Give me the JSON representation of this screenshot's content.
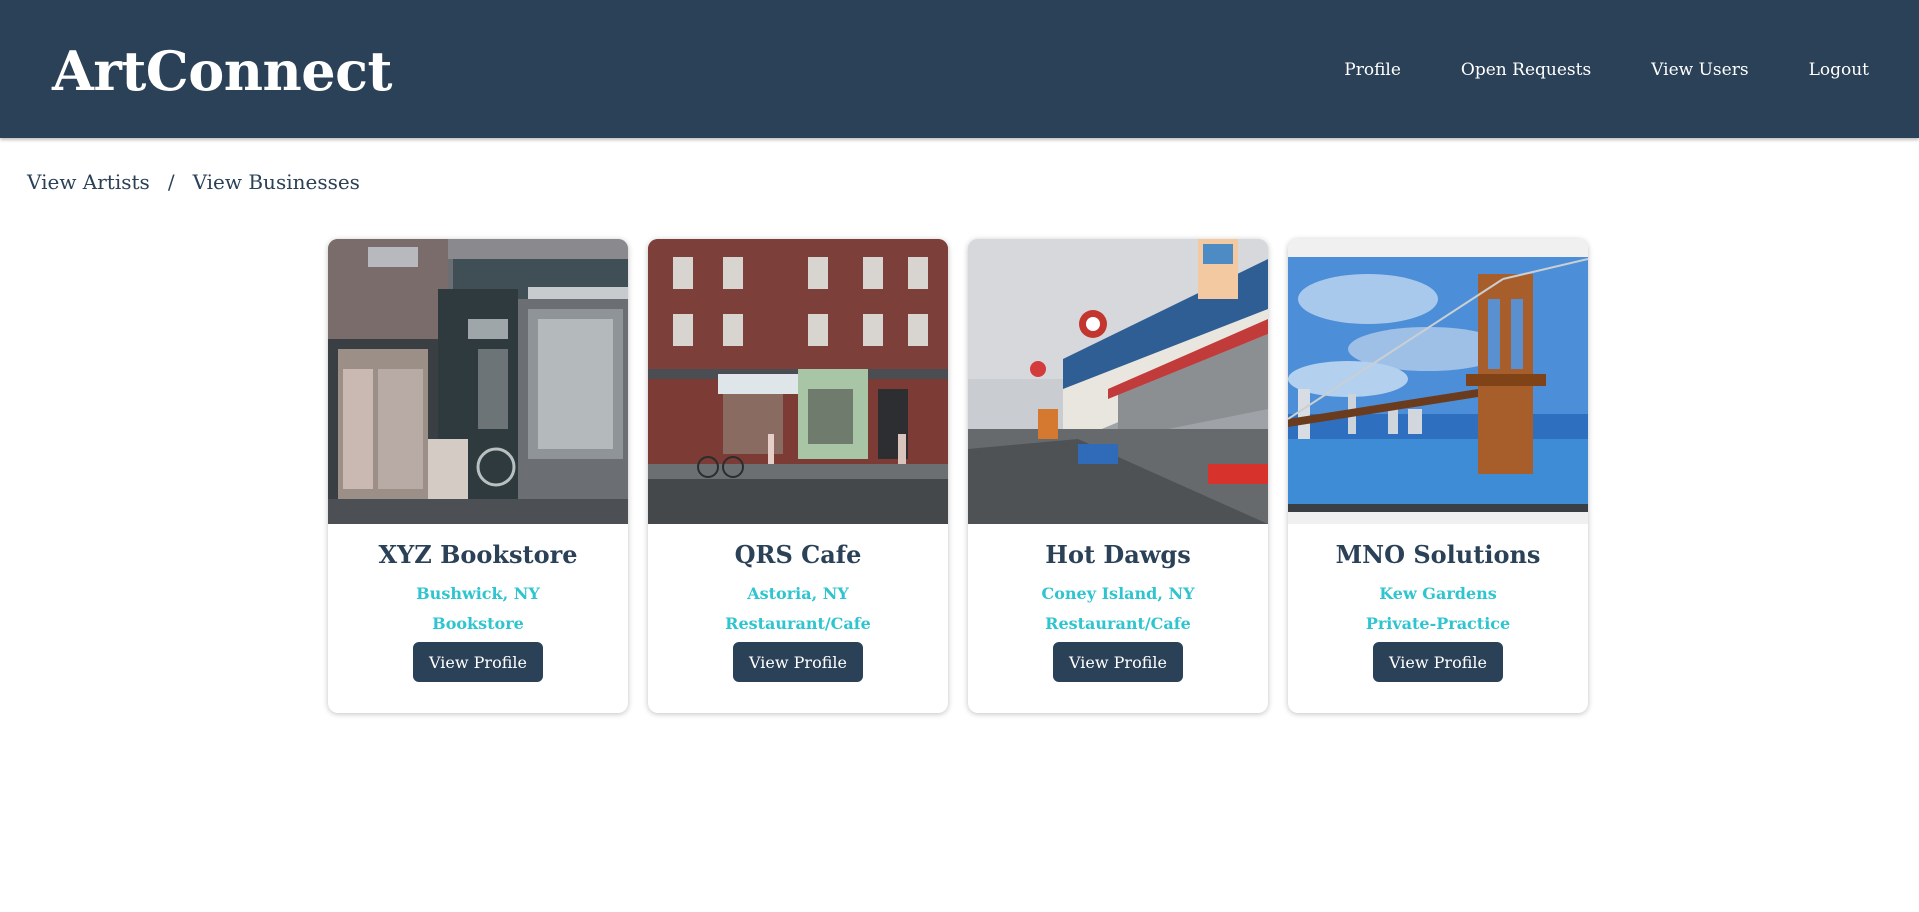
{
  "header": {
    "brand": "ArtConnect",
    "nav": [
      "Profile",
      "Open Requests",
      "View Users",
      "Logout"
    ]
  },
  "breadcrumb": {
    "artists": "View Artists",
    "separator": "/",
    "businesses": "View Businesses"
  },
  "cards": [
    {
      "name": "XYZ Bookstore",
      "location": "Bushwick, NY",
      "category": "Bookstore",
      "button": "View Profile",
      "image": "bookstore-storefront"
    },
    {
      "name": "QRS Cafe",
      "location": "Astoria, NY",
      "category": "Restaurant/Cafe",
      "button": "View Profile",
      "image": "brick-building-street"
    },
    {
      "name": "Hot Dawgs",
      "location": "Coney Island, NY",
      "category": "Restaurant/Cafe",
      "button": "View Profile",
      "image": "boardwalk-storefronts"
    },
    {
      "name": "MNO Solutions",
      "location": "Kew Gardens",
      "category": "Private-Practice",
      "button": "View Profile",
      "image": "bridge-painting"
    }
  ],
  "colors": {
    "header_bg": "#2b4157",
    "accent": "#2ec4d0",
    "button_bg": "#2b4157"
  }
}
